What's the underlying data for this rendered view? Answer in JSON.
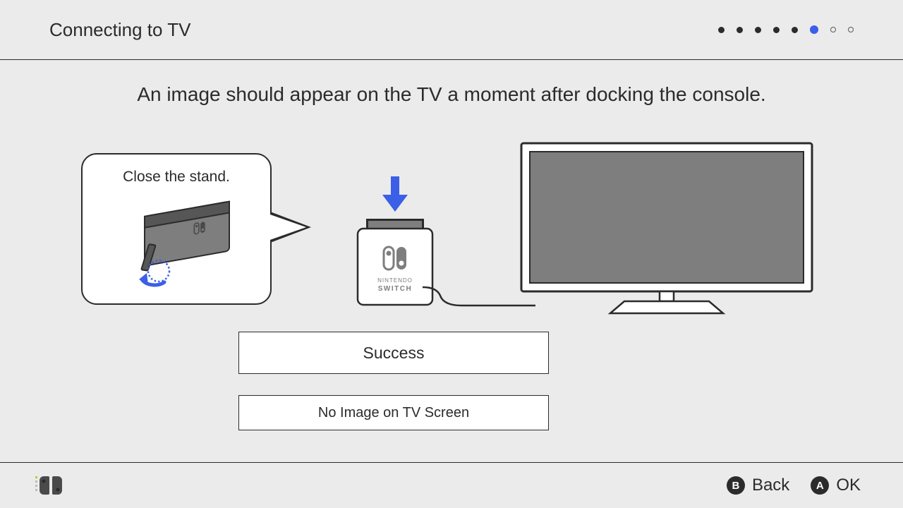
{
  "header": {
    "title": "Connecting to TV",
    "progress": {
      "total": 8,
      "current": 6
    }
  },
  "instruction": "An image should appear on the TV a moment after docking the console.",
  "bubble": {
    "text": "Close the stand."
  },
  "dock": {
    "brand_top": "NINTENDO",
    "brand_bottom": "SWITCH"
  },
  "buttons": {
    "success": "Success",
    "no_image": "No Image on TV Screen"
  },
  "footer": {
    "back": {
      "key": "B",
      "label": "Back"
    },
    "ok": {
      "key": "A",
      "label": "OK"
    }
  },
  "colors": {
    "accent": "#3b5fe6",
    "ink": "#2b2b2b",
    "bg": "#ebebeb",
    "panel": "#ffffff",
    "illustration_fill": "#7e7e7e"
  }
}
